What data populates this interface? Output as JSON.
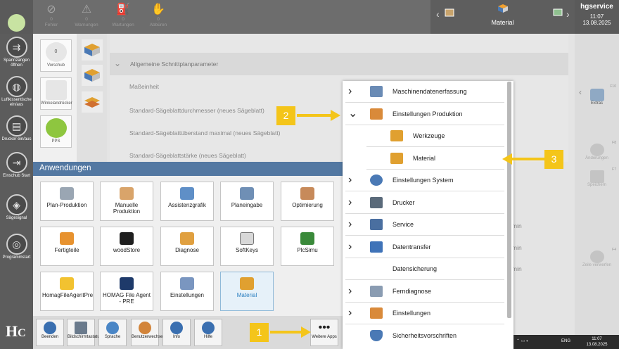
{
  "top_alerts": [
    {
      "count": "0",
      "label": "Fehler",
      "icon": "error-icon"
    },
    {
      "count": "0",
      "label": "Warnungen",
      "icon": "warning-icon"
    },
    {
      "count": "0",
      "label": "Wartungen",
      "icon": "maintenance-icon"
    },
    {
      "count": "0",
      "label": "Abbüren",
      "icon": "hand-icon"
    }
  ],
  "current_app": "Material",
  "user": {
    "name": "hgservice",
    "time": "11:07",
    "date": "13.08.2025"
  },
  "left_sidebar": [
    "Spannzangen öffnen",
    "Luftkissentische ein/aus",
    "Drucker ein/aus",
    "Einschub Start",
    "Sägesignal",
    "Programmstart"
  ],
  "tiles": [
    "Vorschub",
    "Winkelandrücker",
    "PPS"
  ],
  "tile_value": "0",
  "params": {
    "section": "Allgemeine Schnittplanparameter",
    "rows": [
      "Maßeinheit",
      "Standard-Sägeblattdurchmesser (neues Sägeblatt)",
      "Standard-Sägeblattüberstand maximal (neues Sägeblatt)",
      "Standard-Sägeblattstärke (neues Sägeblatt)"
    ],
    "right_values": [
      "min",
      "min",
      "min"
    ]
  },
  "right_sidebar": [
    {
      "label": "Extras",
      "fkey": "F10"
    },
    {
      "label": "Änderungen",
      "fkey": "F8"
    },
    {
      "label": "Speichern",
      "fkey": "F7"
    },
    {
      "label": "Zeile verwerfen",
      "fkey": "F4"
    }
  ],
  "apps_panel": {
    "title": "Anwendungen",
    "items": [
      "Plan-Produktion",
      "Manuelle Produktion",
      "Assistenzgrafik",
      "Planeingabe",
      "Optimierung",
      "Fertigteile",
      "woodStore",
      "Diagnose",
      "SoftKeys",
      "PlcSimu",
      "HomagFileAgentPre",
      "HOMAG File Agent - PRE",
      "Einstellungen",
      "Material"
    ],
    "selected": "Material"
  },
  "bottom_bar": [
    "Beenden",
    "Bildschirmtastatur",
    "Sprache",
    "Benutzerwechsel",
    "Info",
    "Hilfe",
    "Weitere Apps"
  ],
  "menu": [
    {
      "label": "Maschinendatenerfassung",
      "chev": "›",
      "sub": false
    },
    {
      "label": "Einstellungen Produktion",
      "chev": "⌄",
      "sub": false
    },
    {
      "label": "Werkzeuge",
      "chev": "",
      "sub": true
    },
    {
      "label": "Material",
      "chev": "",
      "sub": true
    },
    {
      "label": "Einstellungen System",
      "chev": "›",
      "sub": false
    },
    {
      "label": "Drucker",
      "chev": "›",
      "sub": false
    },
    {
      "label": "Service",
      "chev": "›",
      "sub": false
    },
    {
      "label": "Datentransfer",
      "chev": "›",
      "sub": false
    },
    {
      "label": "Datensicherung",
      "chev": "",
      "sub": false
    },
    {
      "label": "Ferndiagnose",
      "chev": "›",
      "sub": false
    },
    {
      "label": "Einstellungen",
      "chev": "›",
      "sub": false
    },
    {
      "label": "Sicherheitsvorschriften",
      "chev": "",
      "sub": false
    }
  ],
  "callouts": [
    "1",
    "2",
    "3"
  ],
  "taskbar": {
    "lang": "ENG",
    "time": "11:07",
    "date": "13.08.2025"
  },
  "colors": {
    "accent": "#f4c51a",
    "panel_title": "#5378a2",
    "selected_text": "#2a7fc0"
  }
}
